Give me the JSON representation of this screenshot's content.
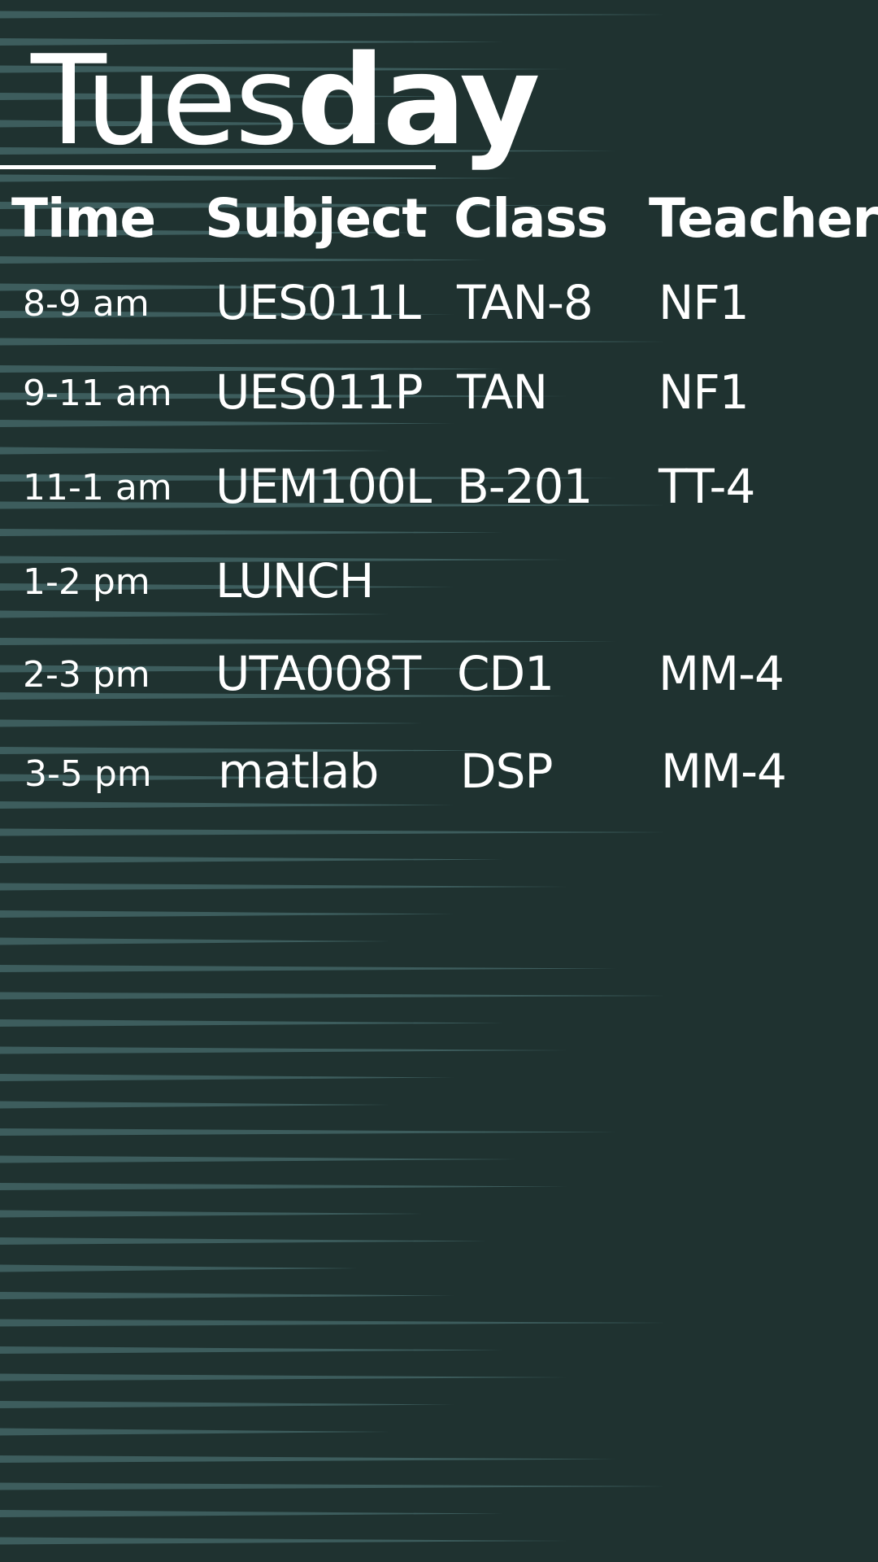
{
  "title": {
    "light": "Tues",
    "bold": "day"
  },
  "headers": {
    "time": "Time",
    "subject": "Subject",
    "class": "Class",
    "teacher": "Teacher"
  },
  "rows": [
    {
      "time": "8-9 am",
      "subject": "UES011L",
      "class": "TAN-8",
      "teacher": "NF1"
    },
    {
      "time": "9-11 am",
      "subject": "UES011P",
      "class": "TAN",
      "teacher": "NF1"
    },
    {
      "time": "11-1 am",
      "subject": "UEM100L",
      "class": "B-201",
      "teacher": "TT-4"
    },
    {
      "time": "1-2 pm",
      "subject": "LUNCH",
      "class": "",
      "teacher": ""
    },
    {
      "time": "2-3 pm",
      "subject": "UTA008T",
      "class": "CD1",
      "teacher": "MM-4"
    },
    {
      "time": "3-5 pm",
      "subject": "matlab",
      "class": "DSP",
      "teacher": "MM-4"
    }
  ],
  "colors": {
    "background": "#1f3230",
    "stripe": "#3d5d5d",
    "text": "#ffffff"
  }
}
